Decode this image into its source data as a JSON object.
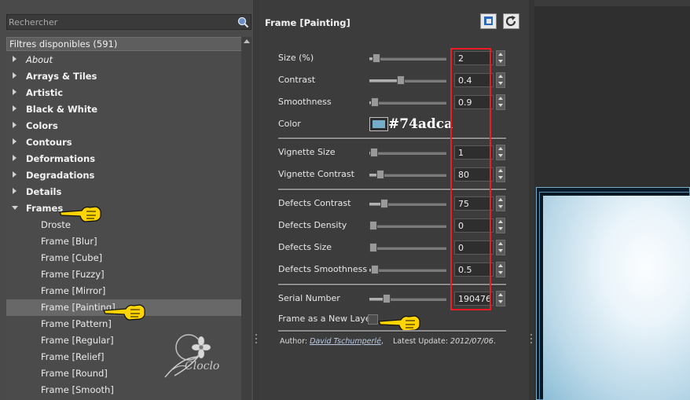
{
  "search": {
    "placeholder": "Rechercher"
  },
  "filters": {
    "header": "Filtres disponibles (591)",
    "items": [
      {
        "label": "About",
        "italic": true,
        "expanded": false
      },
      {
        "label": "Arrays & Tiles",
        "expanded": false
      },
      {
        "label": "Artistic",
        "expanded": false
      },
      {
        "label": "Black & White",
        "expanded": false
      },
      {
        "label": "Colors",
        "expanded": false
      },
      {
        "label": "Contours",
        "expanded": false
      },
      {
        "label": "Deformations",
        "expanded": false
      },
      {
        "label": "Degradations",
        "expanded": false
      },
      {
        "label": "Details",
        "expanded": false
      },
      {
        "label": "Frames",
        "expanded": true
      }
    ],
    "children": [
      {
        "label": "Droste"
      },
      {
        "label": "Frame [Blur]"
      },
      {
        "label": "Frame [Cube]"
      },
      {
        "label": "Frame [Fuzzy]"
      },
      {
        "label": "Frame [Mirror]"
      },
      {
        "label": "Frame [Painting]",
        "selected": true
      },
      {
        "label": "Frame [Pattern]"
      },
      {
        "label": "Frame [Regular]"
      },
      {
        "label": "Frame [Relief]"
      },
      {
        "label": "Frame [Round]"
      },
      {
        "label": "Frame [Smooth]"
      }
    ]
  },
  "watermark": {
    "text": "Cloclo"
  },
  "panel": {
    "title": "Frame [Painting]",
    "params": {
      "size": {
        "label": "Size (%)",
        "value": "2",
        "level": 0.04
      },
      "contrast": {
        "label": "Contrast",
        "value": "0.4",
        "level": 0.4
      },
      "smoothness": {
        "label": "Smoothness",
        "value": "0.9",
        "level": 0.02
      },
      "vignette_size": {
        "label": "Vignette Size",
        "value": "1",
        "level": 0.01
      },
      "vignette_contrast": {
        "label": "Vignette Contrast",
        "value": "80",
        "level": 0.1
      },
      "defects_contrast": {
        "label": "Defects Contrast",
        "value": "75",
        "level": 0.16
      },
      "defects_density": {
        "label": "Defects Density",
        "value": "0",
        "level": 0
      },
      "defects_size": {
        "label": "Defects Size",
        "value": "0",
        "level": 0
      },
      "defects_smoothness": {
        "label": "Defects Smoothness",
        "value": "0.5",
        "level": 0.02
      },
      "serial_number": {
        "label": "Serial Number",
        "value": "190476",
        "level": 0.19
      }
    },
    "color": {
      "label": "Color",
      "hex": "#74adca"
    },
    "new_layer": {
      "label": "Frame as a New Layer",
      "checked": false
    },
    "author_label": "Author:",
    "author_name": "David Tschumperlé",
    "update_label": "Latest Update:",
    "update_date": "2012/07/06"
  },
  "colors": {
    "swatch": "#74adca",
    "highlight_box": "#ee1c24",
    "pointer": "#ffd400"
  },
  "icons": [
    "search-icon",
    "copy-icon",
    "refresh-icon",
    "hand-pointer-icon",
    "chevron-right-icon",
    "chevron-down-icon"
  ]
}
